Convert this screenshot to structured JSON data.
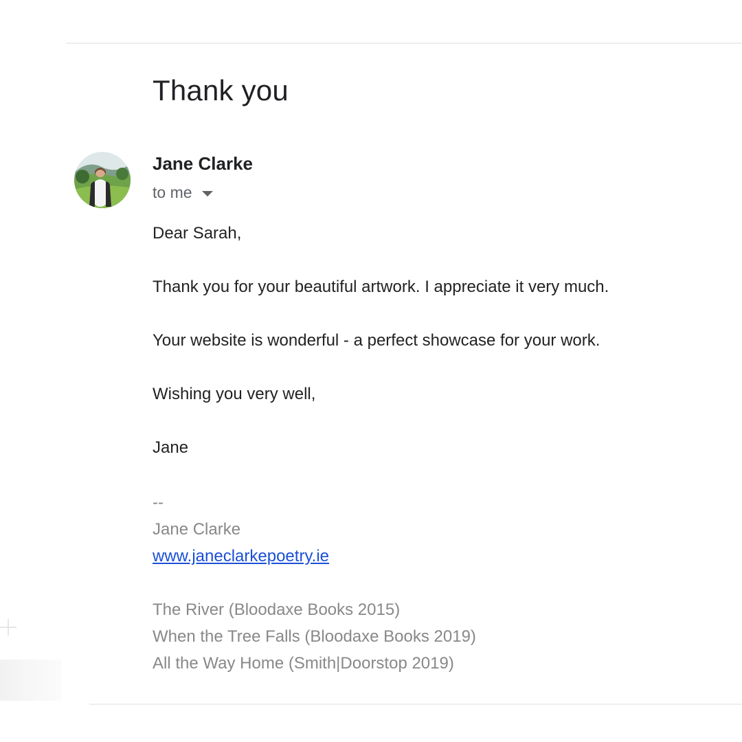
{
  "email": {
    "subject": "Thank you",
    "sender_name": "Jane Clarke",
    "recipient_label": "to me",
    "body": [
      "Dear Sarah,",
      "Thank you for your beautiful artwork. I appreciate it very much.",
      "Your website is wonderful - a perfect showcase for your work.",
      "Wishing you very well,",
      "Jane"
    ],
    "signature": {
      "separator": "--",
      "name": "Jane Clarke",
      "website": "www.janeclarkepoetry.ie",
      "books": [
        "The River (Bloodaxe Books 2015)",
        "When the Tree Falls (Bloodaxe Books 2019)",
        "All the Way Home (Smith|Doorstop 2019)"
      ]
    }
  },
  "colors": {
    "link": "#1a4fd6",
    "muted": "#888888",
    "text": "#222222",
    "secondary": "#5f6368"
  },
  "icons": {
    "recipient_dropdown": "caret-down-icon"
  }
}
